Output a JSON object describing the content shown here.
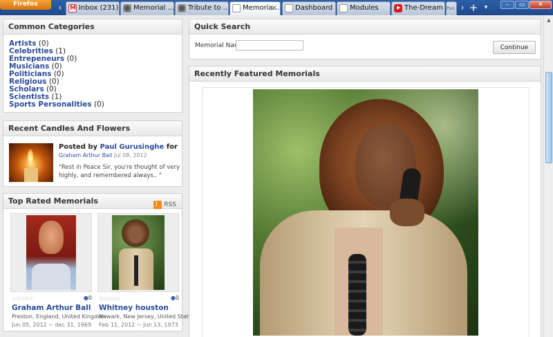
{
  "browser": {
    "menu_label": "Firefox",
    "tabs": [
      {
        "title": "Inbox (231) ..."
      },
      {
        "title": "Memorial ..."
      },
      {
        "title": "Tribute to ..."
      },
      {
        "title": "Memoria...",
        "close": "×"
      },
      {
        "title": "Dashboard"
      },
      {
        "title": "Modules"
      },
      {
        "title": "The-Dream ..."
      },
      {
        "title": "Pun"
      }
    ],
    "nav": {
      "back": "‹",
      "forward": "›",
      "new_tab": "+",
      "list": "▾"
    },
    "window": {
      "minimize": "–",
      "maximize": "▭",
      "close": "✕"
    }
  },
  "categories": {
    "heading": "Common Categories",
    "items": [
      {
        "label": "Artists",
        "count": "(0)"
      },
      {
        "label": "Celebrities",
        "count": "(1)"
      },
      {
        "label": "Entrepeneurs",
        "count": "(0)"
      },
      {
        "label": "Musicians",
        "count": "(0)"
      },
      {
        "label": "Politicians",
        "count": "(0)"
      },
      {
        "label": "Religious",
        "count": "(0)"
      },
      {
        "label": "Scholars",
        "count": "(0)"
      },
      {
        "label": "Scientists",
        "count": "(1)"
      },
      {
        "label": "Sports Personalities",
        "count": "(0)"
      }
    ]
  },
  "candles": {
    "heading": "Recent Candles And Flowers",
    "posted_by_label": "Posted by",
    "author": "Paul Gurusinghe",
    "for_label": "for",
    "memorial": "Graham Arthur Ball",
    "date": "Jul 08, 2012",
    "message": "\"Rest in Peace Sir, you're thought of very highly, and remembered always.. \""
  },
  "top_rated": {
    "heading": "Top Rated Memorials",
    "rss_label": "RSS",
    "cards": [
      {
        "name": "Graham Arthur Ball",
        "place": "Preston, England, United Kingdom",
        "dates": "Jun 05, 2012 ~ dec 31, 1969",
        "candles": "0",
        "stars": "☆☆☆☆☆"
      },
      {
        "name": "Whitney houston",
        "place": "Newark, New Jersey, United State",
        "dates": "Feb 11, 2012 ~ Jun 13, 1973",
        "candles": "0",
        "stars": "☆☆☆☆☆"
      }
    ]
  },
  "quick_search": {
    "heading": "Quick Search",
    "field_label": "Memorial Name",
    "field_value": "",
    "button": "Continue"
  },
  "featured": {
    "heading": "Recently Featured Memorials"
  },
  "colors": {
    "link": "#2a4a9a",
    "tabbar": "#1f4a8c",
    "firefox": "#e8861f"
  }
}
